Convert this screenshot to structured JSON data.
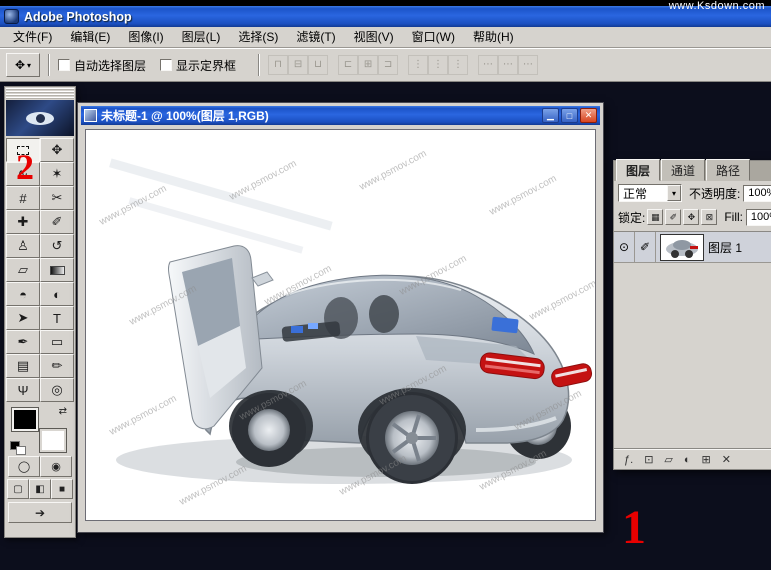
{
  "site_watermark": "www.Ksdown.com",
  "titlebar": {
    "title": "Adobe Photoshop"
  },
  "menubar": {
    "items": [
      "文件(F)",
      "编辑(E)",
      "图像(I)",
      "图层(L)",
      "选择(S)",
      "滤镜(T)",
      "视图(V)",
      "窗口(W)",
      "帮助(H)"
    ]
  },
  "optionsbar": {
    "tool_glyph": "✥",
    "dropdown_arrow": "▾",
    "auto_select_label": "自动选择图层",
    "bounding_box_label": "显示定界框",
    "align_icons": [
      "⊓",
      "⊟",
      "⊔",
      "⊏",
      "⊞",
      "⊐",
      "⋮",
      "⋮",
      "⋮",
      "⋯",
      "⋯",
      "⋯"
    ]
  },
  "toolbox": {
    "tools": [
      {
        "name": "rectangular-marquee",
        "glyph": ""
      },
      {
        "name": "move",
        "glyph": "✥"
      },
      {
        "name": "lasso",
        "glyph": "∿"
      },
      {
        "name": "magic-wand",
        "glyph": "✶"
      },
      {
        "name": "crop",
        "glyph": "#"
      },
      {
        "name": "slice",
        "glyph": "✂"
      },
      {
        "name": "healing-brush",
        "glyph": "✚"
      },
      {
        "name": "brush",
        "glyph": "✐"
      },
      {
        "name": "clone-stamp",
        "glyph": "♙"
      },
      {
        "name": "history-brush",
        "glyph": "↺"
      },
      {
        "name": "eraser",
        "glyph": "▱"
      },
      {
        "name": "gradient",
        "glyph": ""
      },
      {
        "name": "blur",
        "glyph": "◓"
      },
      {
        "name": "dodge",
        "glyph": "◐"
      },
      {
        "name": "path-selection",
        "glyph": "➤"
      },
      {
        "name": "type",
        "glyph": "T"
      },
      {
        "name": "pen",
        "glyph": "✒"
      },
      {
        "name": "custom-shape",
        "glyph": "▭"
      },
      {
        "name": "notes",
        "glyph": "▤"
      },
      {
        "name": "eyedropper",
        "glyph": "✏"
      },
      {
        "name": "hand",
        "glyph": "Ψ"
      },
      {
        "name": "zoom",
        "glyph": "◎"
      }
    ],
    "swap_icon": "⇄",
    "quickmask_icons": [
      "◯",
      "◉"
    ],
    "screenmode_icons": [
      "▢",
      "◧",
      "■"
    ],
    "imageready_icon": "➔"
  },
  "document": {
    "title": "未标题-1 @ 100%(图层 1,RGB)",
    "canvas_watermark": "www.psmov.com",
    "window_buttons": {
      "minimize": "▁",
      "maximize": "□",
      "close": "✕"
    }
  },
  "layers_panel": {
    "tabs": [
      "图层",
      "通道",
      "路径"
    ],
    "blend_mode": "正常",
    "dropdown_arrow": "▾",
    "opacity_label": "不透明度:",
    "opacity_value": "100%",
    "lock_label": "锁定:",
    "lock_icons": [
      "▦",
      "✐",
      "✥",
      "⊠"
    ],
    "fill_label": "Fill:",
    "fill_value": "100%",
    "layer_row": {
      "eye_icon": "⊙",
      "edit_icon": "✐",
      "name": "图层 1"
    },
    "bottom_icons": [
      "ƒ.",
      "⊡",
      "▱",
      "◐",
      "⊞",
      "✕"
    ]
  },
  "annotations": {
    "step_1": "1",
    "step_2": "2"
  }
}
